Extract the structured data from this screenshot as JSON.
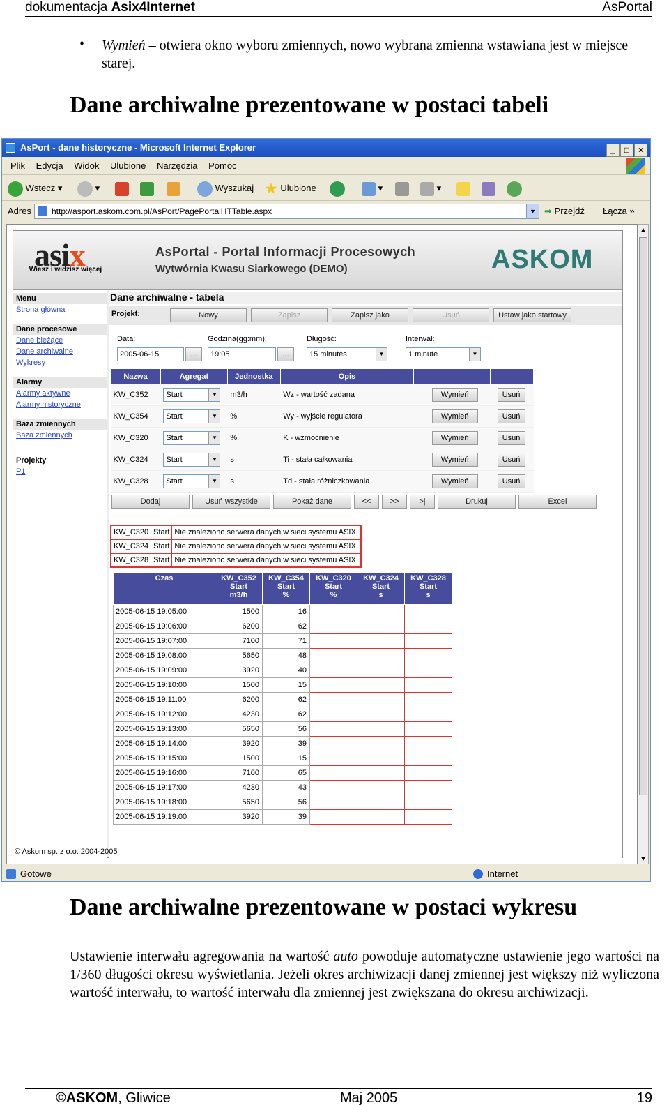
{
  "header": {
    "left_normal": "dokumentacja ",
    "left_bold": "Asix4Internet",
    "right": "AsPortal"
  },
  "bullet": {
    "italic": "Wymień",
    "rest": " – otwiera okno wyboru zmiennych, nowo wybrana zmienna wstawiana jest w miejsce starej."
  },
  "heading1": "Dane archiwalne prezentowane w postaci tabeli",
  "heading2": "Dane archiwalne prezentowane w postaci wykresu",
  "paragraph": {
    "before": "Ustawienie interwału agregowania na wartość ",
    "italic": "auto",
    "after": " powoduje automatyczne ustawienie jego wartości na 1/360 długości okresu wyświetlania. Jeżeli okres archiwizacji danej zmiennej jest większy niż wyliczona wartość interwału, to wartość interwału dla zmiennej jest zwiększana do okresu archiwizacji."
  },
  "footer": {
    "left": "©ASKOM",
    "left_suffix": ", Gliwice",
    "center": "Maj 2005",
    "right": "19"
  },
  "browser": {
    "title": "AsPort - dane historyczne - Microsoft Internet Explorer",
    "menu": [
      "Plik",
      "Edycja",
      "Widok",
      "Ulubione",
      "Narzędzia",
      "Pomoc"
    ],
    "toolbar": {
      "back": "Wstecz",
      "search": "Wyszukaj",
      "favorites": "Ulubione"
    },
    "address_label": "Adres",
    "url": "http://asport.askom.com.pl/AsPort/PagePortalHTTable.aspx",
    "go": "Przejdź",
    "links": "Łącza",
    "status": "Gotowe",
    "zone": "Internet"
  },
  "portal": {
    "logo_main": "asi",
    "logo_x": "x",
    "logo_sub": "Wiesz i widzisz więcej",
    "banner_title": "AsPortal - Portal Informacji Procesowych",
    "banner_sub": "Wytwórnia Kwasu Siarkowego (DEMO)",
    "brand": "ASKOM",
    "sidebar": {
      "menu_title": "Menu",
      "home": "Strona główna",
      "proc_title": "Dane procesowe",
      "proc_items": [
        "Dane bieżące",
        "Dane archiwalne",
        "Wykresy"
      ],
      "alarm_title": "Alarmy",
      "alarm_items": [
        "Alarmy aktywne",
        "Alarmy historyczne"
      ],
      "var_title": "Baza zmiennych",
      "var_items": [
        "Baza zmiennych"
      ],
      "proj_title": "Projekty",
      "proj_items": [
        "P1"
      ]
    },
    "page_title": "Dane archiwalne - tabela",
    "project_label": "Projekt:",
    "project_buttons": [
      "Nowy",
      "Zapisz",
      "Zapisz jako",
      "Usuń",
      "Ustaw jako startowy"
    ],
    "filters": {
      "date_label": "Data:",
      "date_value": "2005-06-15",
      "time_label": "Godzina(gg:mm):",
      "time_value": "19:05",
      "length_label": "Długość:",
      "length_value": "15 minutes",
      "interval_label": "Interwał:",
      "interval_value": "1 minute",
      "pick": "..."
    },
    "var_headers": [
      "Nazwa",
      "Agregat",
      "Jednostka",
      "Opis",
      "",
      ""
    ],
    "variables": [
      {
        "name": "KW_C352",
        "agg": "Start",
        "unit": "m3/h",
        "desc": "Wz - wartość zadana"
      },
      {
        "name": "KW_C354",
        "agg": "Start",
        "unit": "%",
        "desc": "Wy - wyjście regulatora"
      },
      {
        "name": "KW_C320",
        "agg": "Start",
        "unit": "%",
        "desc": "K - wzmocnienie"
      },
      {
        "name": "KW_C324",
        "agg": "Start",
        "unit": "s",
        "desc": "Ti - stała całkowania"
      },
      {
        "name": "KW_C328",
        "agg": "Start",
        "unit": "s",
        "desc": "Td - stała różniczkowania"
      }
    ],
    "replace_label": "Wymień",
    "remove_label": "Usuń",
    "action_buttons": [
      "Dodaj",
      "Usuń wszystkie",
      "Pokaż dane",
      "<<",
      ">>",
      ">|",
      "Drukuj",
      "Excel"
    ],
    "errors": [
      {
        "name": "KW_C320",
        "agg": "Start",
        "msg": "Nie znaleziono serwera danych w sieci systemu ASIX."
      },
      {
        "name": "KW_C324",
        "agg": "Start",
        "msg": "Nie znaleziono serwera danych w sieci systemu ASIX."
      },
      {
        "name": "KW_C328",
        "agg": "Start",
        "msg": "Nie znaleziono serwera danych w sieci systemu ASIX."
      }
    ],
    "data_headers": [
      {
        "l1": "Czas",
        "l2": "",
        "l3": ""
      },
      {
        "l1": "KW_C352",
        "l2": "Start",
        "l3": "m3/h"
      },
      {
        "l1": "KW_C354",
        "l2": "Start",
        "l3": "%"
      },
      {
        "l1": "KW_C320",
        "l2": "Start",
        "l3": "%"
      },
      {
        "l1": "KW_C324",
        "l2": "Start",
        "l3": "s"
      },
      {
        "l1": "KW_C328",
        "l2": "Start",
        "l3": "s"
      }
    ],
    "data_rows": [
      [
        "2005-06-15 19:05:00",
        "1500",
        "16"
      ],
      [
        "2005-06-15 19:06:00",
        "6200",
        "62"
      ],
      [
        "2005-06-15 19:07:00",
        "7100",
        "71"
      ],
      [
        "2005-06-15 19:08:00",
        "5650",
        "48"
      ],
      [
        "2005-06-15 19:09:00",
        "3920",
        "40"
      ],
      [
        "2005-06-15 19:10:00",
        "1500",
        "15"
      ],
      [
        "2005-06-15 19:11:00",
        "6200",
        "62"
      ],
      [
        "2005-06-15 19:12:00",
        "4230",
        "62"
      ],
      [
        "2005-06-15 19:13:00",
        "5650",
        "56"
      ],
      [
        "2005-06-15 19:14:00",
        "3920",
        "39"
      ],
      [
        "2005-06-15 19:15:00",
        "1500",
        "15"
      ],
      [
        "2005-06-15 19:16:00",
        "7100",
        "65"
      ],
      [
        "2005-06-15 19:17:00",
        "4230",
        "43"
      ],
      [
        "2005-06-15 19:18:00",
        "5650",
        "56"
      ],
      [
        "2005-06-15 19:19:00",
        "3920",
        "39"
      ]
    ],
    "copyright": "© Askom sp. z o.o. 2004-2005"
  }
}
